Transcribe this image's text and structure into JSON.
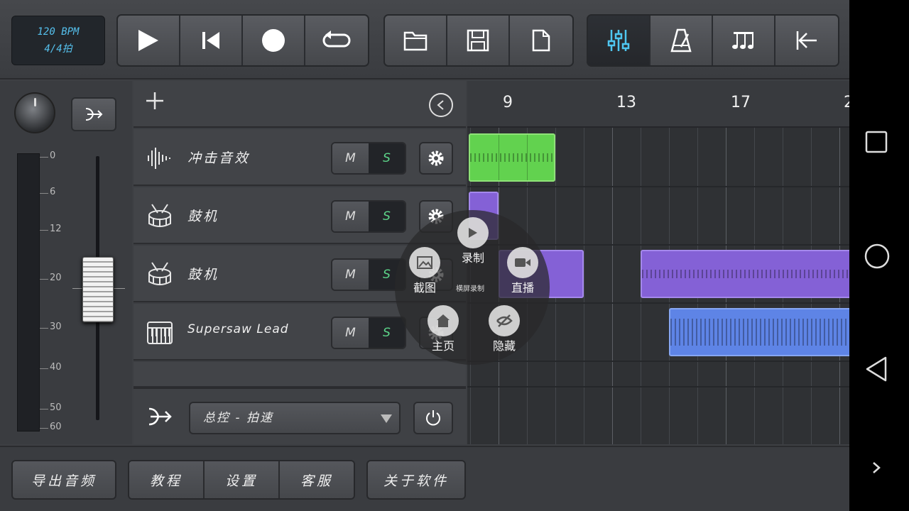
{
  "transport": {
    "bpm": "120 BPM",
    "time_sig": "4/4拍"
  },
  "toolbar": {
    "buttons": [
      "play-icon",
      "skip-back-icon",
      "record-icon",
      "loop-icon",
      "folder-icon",
      "save-icon",
      "new-file-icon",
      "mixer-sliders-icon",
      "metronome-icon",
      "notes-icon",
      "return-to-start-icon"
    ],
    "accent_color": "#55c1ee"
  },
  "mixer": {
    "scale_labels": [
      "0",
      "6",
      "12",
      "20",
      "30",
      "40",
      "50",
      "60"
    ]
  },
  "tracks": [
    {
      "name": "冲击音效",
      "icon": "waveform-icon",
      "mute": "M",
      "solo": "S"
    },
    {
      "name": "鼓机",
      "icon": "drum-icon",
      "mute": "M",
      "solo": "S"
    },
    {
      "name": "鼓机",
      "icon": "drum-icon",
      "mute": "M",
      "solo": "S"
    },
    {
      "name": "Supersaw Lead",
      "icon": "piano-icon",
      "mute": "M",
      "solo": "S"
    }
  ],
  "master": {
    "selector_value": "总控 - 拍速"
  },
  "ruler": {
    "bars": [
      "9",
      "13",
      "17",
      "2"
    ]
  },
  "bottom": {
    "export": "导出音频",
    "tutorial": "教程",
    "settings": "设置",
    "support": "客服",
    "about": "关于软件"
  },
  "overlay": {
    "record": "录制",
    "screenshot": "截图",
    "live": "直播",
    "home": "主页",
    "hide": "隐藏",
    "screen_record": "横屏录制"
  }
}
